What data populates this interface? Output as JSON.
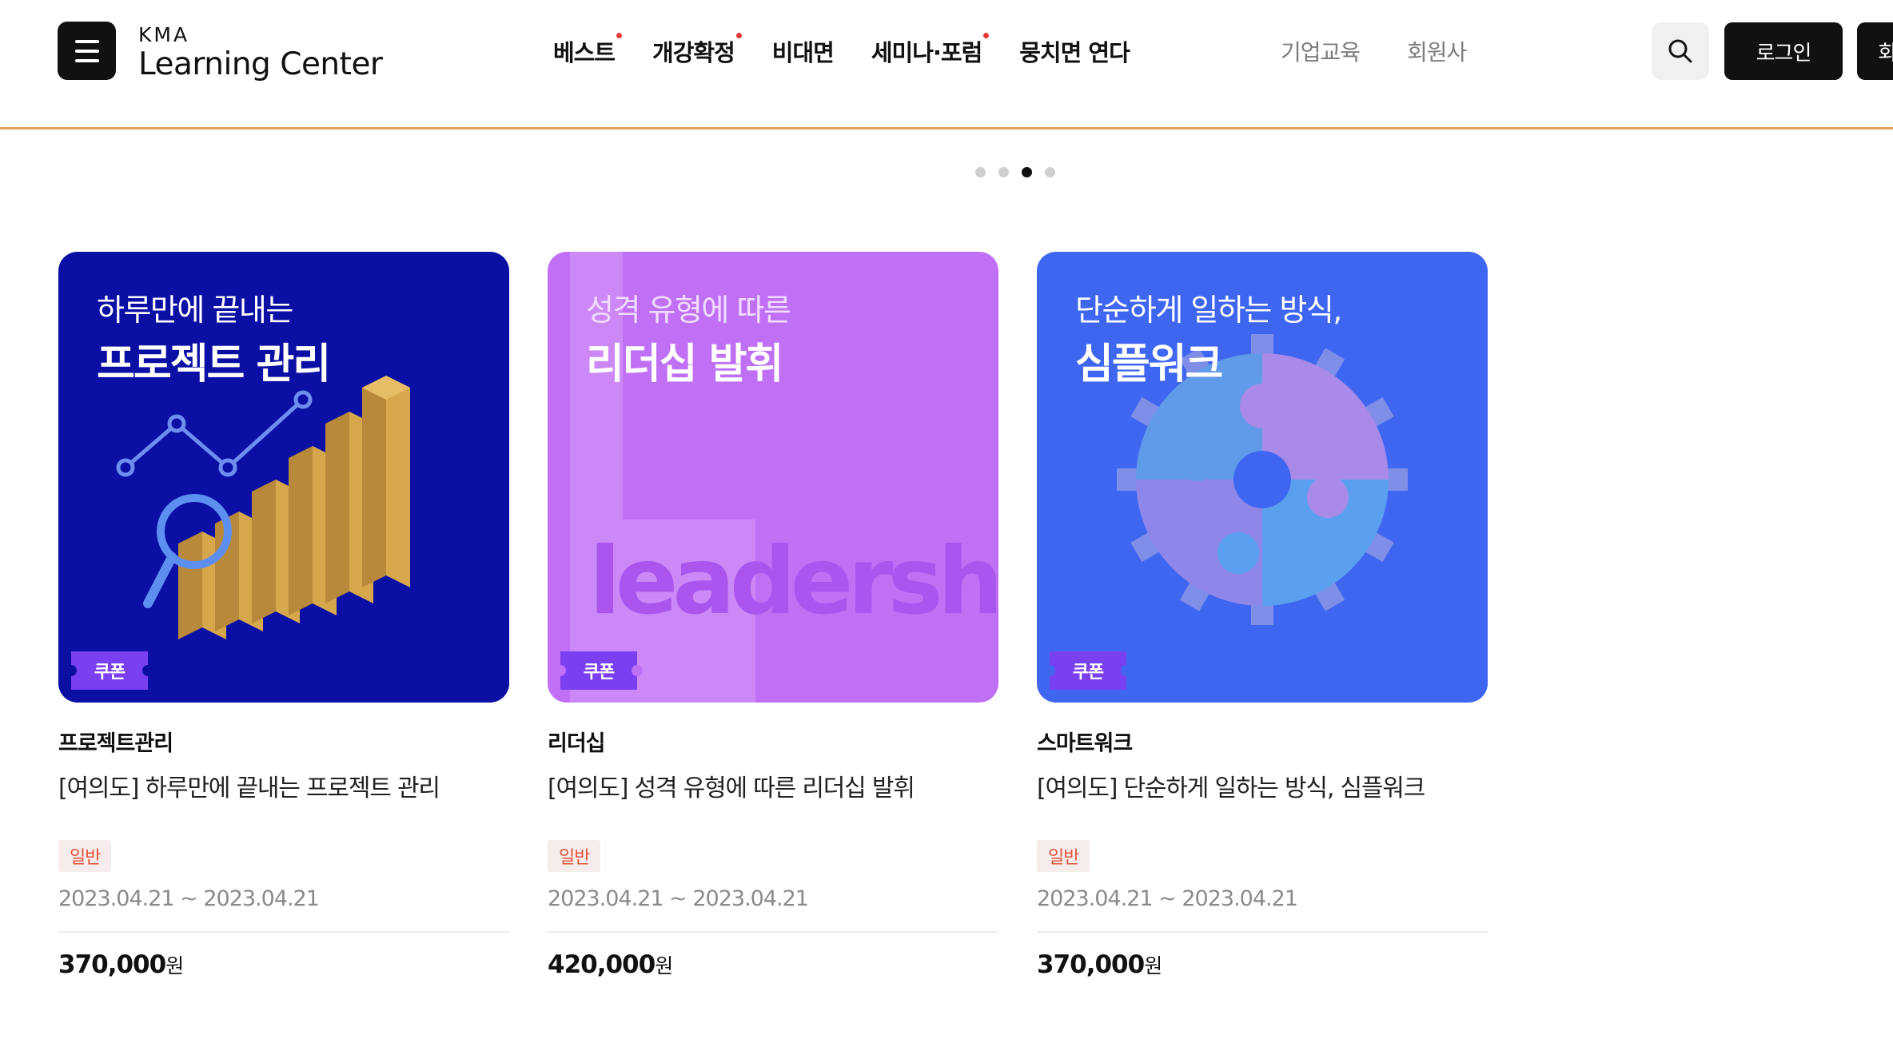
{
  "header": {
    "logo_small": "KMA",
    "logo_big": "Learning Center",
    "nav": [
      {
        "label": "베스트",
        "dot": true
      },
      {
        "label": "개강확정",
        "dot": true
      },
      {
        "label": "비대면",
        "dot": false
      },
      {
        "label": "세미나·포럼",
        "dot": true
      },
      {
        "label": "뭉치면 연다",
        "dot": false
      }
    ],
    "nav_sub": [
      "기업교육",
      "회원사"
    ],
    "login_label": "로그인",
    "join_label": "회원가입",
    "icons": {
      "menu": "hamburger-icon",
      "search": "search-icon"
    }
  },
  "carousel": {
    "total": 4,
    "active_index": 2
  },
  "cards": [
    {
      "thumb_sub": "하루만에 끝내는",
      "thumb_title": "프로젝트 관리",
      "coupon": "쿠폰",
      "category": "프로젝트관리",
      "title": "[여의도] 하루만에 끝내는 프로젝트 관리",
      "badge": "일반",
      "date": "2023.04.21 ~ 2023.04.21",
      "price": "370,000",
      "currency": "원",
      "bg_color": "#0b0fa3"
    },
    {
      "thumb_sub": "성격 유형에 따른",
      "thumb_title": "리더십 발휘",
      "thumb_watermark": "leadership",
      "coupon": "쿠폰",
      "category": "리더십",
      "title": "[여의도] 성격 유형에 따른 리더십 발휘",
      "badge": "일반",
      "date": "2023.04.21 ~ 2023.04.21",
      "price": "420,000",
      "currency": "원",
      "bg_color": "#c070f5"
    },
    {
      "thumb_sub": "단순하게 일하는 방식,",
      "thumb_title": "심플워크",
      "coupon": "쿠폰",
      "category": "스마트워크",
      "title": "[여의도] 단순하게 일하는 방식, 심플워크",
      "badge": "일반",
      "date": "2023.04.21 ~ 2023.04.21",
      "price": "370,000",
      "currency": "원",
      "bg_color": "#3f66f0"
    }
  ],
  "colors": {
    "accent_line": "#e2a25d",
    "new_dot": "#e53935",
    "coupon": "#7b3ff2",
    "badge_text": "#e0533a"
  }
}
